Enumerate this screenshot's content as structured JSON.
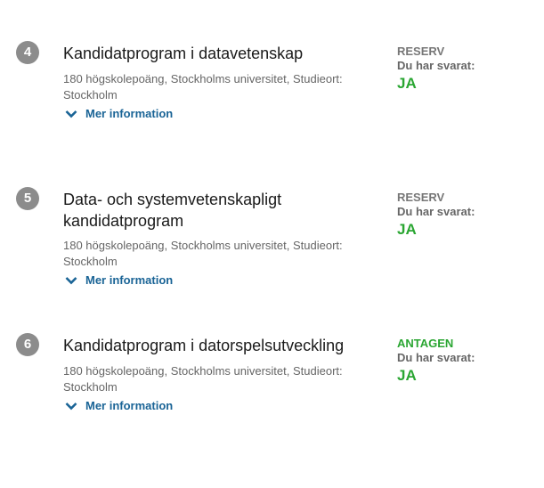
{
  "items": [
    {
      "number": "4",
      "title": "Kandidatprogram i datavetenskap",
      "meta": "180 högskolepoäng, Stockholms universitet, Studieort: Stockholm",
      "more_label": "Mer information",
      "status": "RESERV",
      "answered_label": "Du har svarat:",
      "answer": "JA"
    },
    {
      "number": "5",
      "title": "Data- och systemvetenskapligt kandidatprogram",
      "meta": "180 högskolepoäng, Stockholms universitet, Studieort: Stockholm",
      "more_label": "Mer information",
      "status": "RESERV",
      "answered_label": "Du har svarat:",
      "answer": "JA"
    },
    {
      "number": "6",
      "title": "Kandidatprogram i datorspelsutveckling",
      "meta": "180 högskolepoäng, Stockholms universitet, Studieort: Stockholm",
      "more_label": "Mer information",
      "status": "ANTAGEN",
      "answered_label": "Du har svarat:",
      "answer": "JA"
    }
  ],
  "colors": {
    "accepted": "#2aa632",
    "reserve": "#777777",
    "link": "#1a6496"
  },
  "icons": {
    "more": "chevron-down-icon"
  }
}
